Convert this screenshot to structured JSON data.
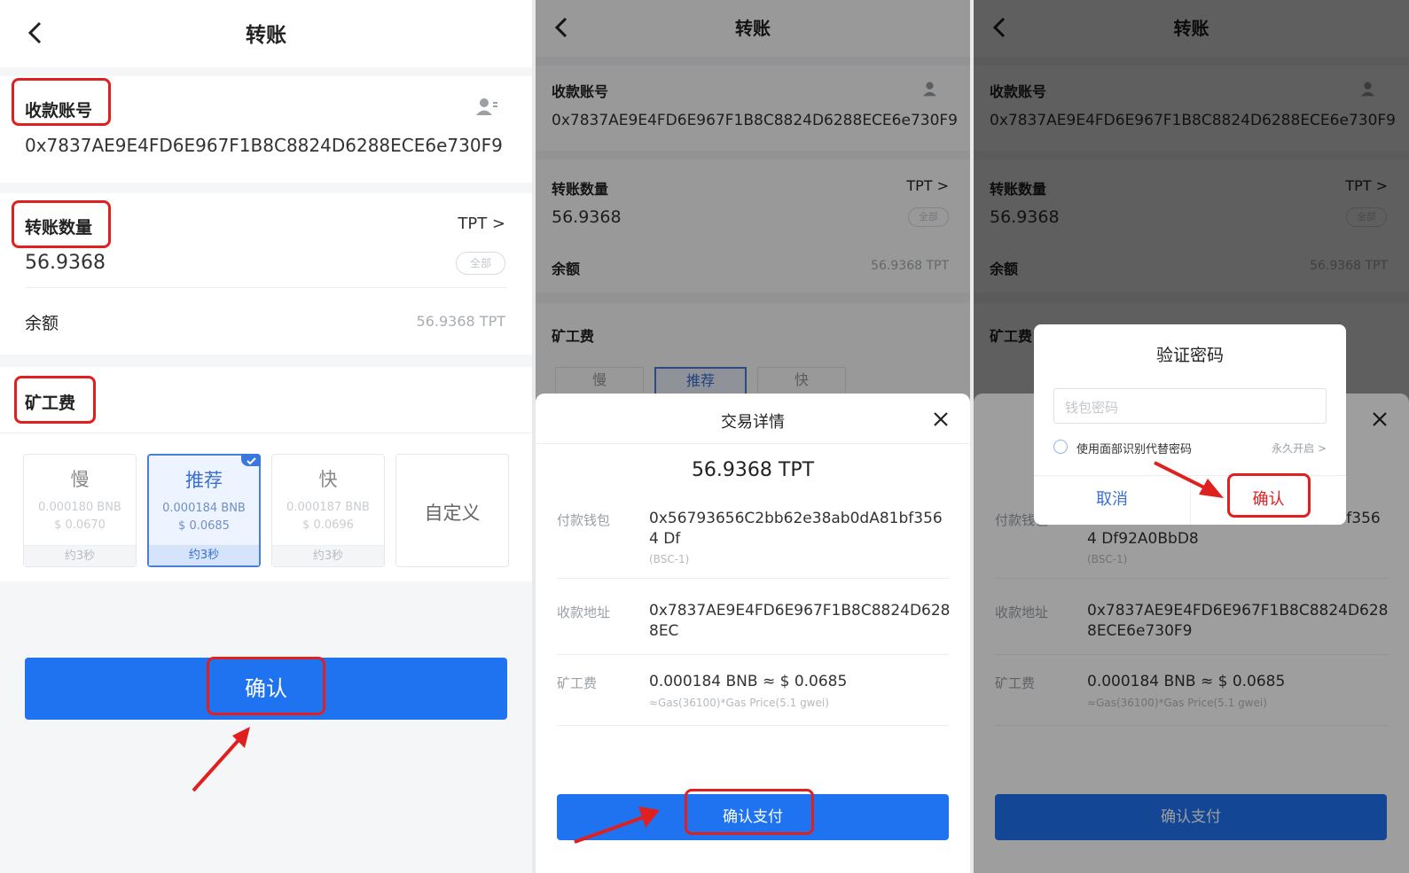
{
  "colors": {
    "accent": "#1f73f1",
    "highlight": "#e0201f"
  },
  "panel1": {
    "title": "转账",
    "recipient_label": "收款账号",
    "recipient_address": "0x7837AE9E4FD6E967F1B8C8824D6288ECE6e730F9",
    "amount_label": "转账数量",
    "token": "TPT >",
    "amount": "56.9368",
    "all_label": "全部",
    "balance_label": "余额",
    "balance_value": "56.9368 TPT",
    "fee_label": "矿工费",
    "fee_options": [
      {
        "name": "慢",
        "bnb": "0.000180 BNB",
        "usd": "$ 0.0670",
        "time": "约3秒"
      },
      {
        "name": "推荐",
        "bnb": "0.000184 BNB",
        "usd": "$ 0.0685",
        "time": "约3秒"
      },
      {
        "name": "快",
        "bnb": "0.000187 BNB",
        "usd": "$ 0.0696",
        "time": "约3秒"
      }
    ],
    "custom_label": "自定义",
    "confirm_label": "确认"
  },
  "panel2": {
    "title": "转账",
    "recipient_label": "收款账号",
    "recipient_address": "0x7837AE9E4FD6E967F1B8C8824D6288ECE6e730F9",
    "amount_label": "转账数量",
    "token": "TPT >",
    "amount": "56.9368",
    "all_label": "全部",
    "balance_label": "余额",
    "balance_value": "56.9368 TPT",
    "fee_label": "矿工费",
    "peek_slow": "慢",
    "peek_rec": "推荐",
    "peek_fast": "快",
    "sheet": {
      "title": "交易详情",
      "amount": "56.9368 TPT",
      "from_label": "付款钱包",
      "from_value": "0x56793656C2bb62e38ab0dA81bf3564 Df ",
      "from_net": "(BSC-1)",
      "to_label": "收款地址",
      "to_value": "0x7837AE9E4FD6E967F1B8C8824D628 8EC",
      "fee_label": "矿工费",
      "fee_value": "0.000184 BNB ≈ $ 0.0685",
      "fee_formula": "≈Gas(36100)*Gas Price(5.1 gwei)",
      "pay_label": "确认支付"
    }
  },
  "panel3": {
    "title": "转账",
    "recipient_label": "收款账号",
    "recipient_address": "0x7837AE9E4FD6E967F1B8C8824D6288ECE6e730F9",
    "amount_label": "转账数量",
    "token": "TPT >",
    "amount": "56.9368",
    "all_label": "全部",
    "balance_label": "余额",
    "balance_value": "56.9368 TPT",
    "fee_label": "矿工费",
    "sheet": {
      "from_label": "付款钱包",
      "from_value": "0x56793656C2bb62e38ab0dA81bf3564 Df92A0BbD8",
      "from_net": "(BSC-1)",
      "to_label": "收款地址",
      "to_value": "0x7837AE9E4FD6E967F1B8C8824D628 8ECE6e730F9",
      "fee_label": "矿工费",
      "fee_value": "0.000184 BNB ≈ $ 0.0685",
      "fee_formula": "≈Gas(36100)*Gas Price(5.1 gwei)",
      "pay_label": "确认支付"
    },
    "dialog": {
      "title": "验证密码",
      "placeholder": "钱包密码",
      "face_id_label": "使用面部识别代替密码",
      "always_on": "永久开启 >",
      "cancel_label": "取消",
      "confirm_label": "确认"
    }
  }
}
